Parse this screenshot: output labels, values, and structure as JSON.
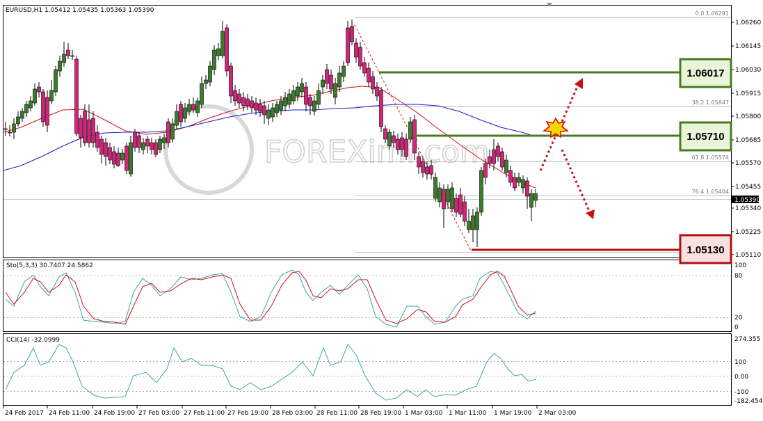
{
  "symbol_header": "EURUSD,H1  1.05412 1.05435 1.05363 1.05390",
  "current_price": "1.05390",
  "watermark": "FOREXimf.com",
  "price_axis": [
    "1.06260",
    "1.06145",
    "1.06030",
    "1.05915",
    "1.05800",
    "1.05685",
    "1.05570",
    "1.05455",
    "1.05340",
    "1.05225",
    "1.05110"
  ],
  "fibo": [
    "0.0  1.06291",
    "38.2  1.05847",
    "61.8  1.05574",
    "76.4  1.05404"
  ],
  "levels": [
    {
      "label": "1.06017",
      "color": "#4a7a20",
      "fill": "#e9f5d8"
    },
    {
      "label": "1.05710",
      "color": "#4a7a20",
      "fill": "#e9f5d8"
    },
    {
      "label": "1.05130",
      "color": "#b01010",
      "fill": "#fbe0e0"
    }
  ],
  "stoch": {
    "title": "Sto(5,3,3) 30.7407 24.5862",
    "axis": [
      "100",
      "80",
      "20",
      "0"
    ]
  },
  "cci": {
    "title": "CCI(14) -32.0999",
    "axis": [
      "274.355",
      "100",
      "0.00",
      "-100",
      "-182.4542"
    ]
  },
  "time_axis": [
    "24 Feb 2017",
    "24 Feb 11:00",
    "24 Feb 19:00",
    "27 Feb 03:00",
    "27 Feb 11:00",
    "27 Feb 19:00",
    "28 Feb 03:00",
    "28 Feb 11:00",
    "28 Feb 19:00",
    "1 Mar 03:00",
    "1 Mar 11:00",
    "1 Mar 19:00",
    "2 Mar 03:00"
  ],
  "colors": {
    "bull": "#3c7a2c",
    "bear": "#d4247a",
    "ma_fast": "#d41010",
    "ma_slow": "#1a1ad4",
    "stoch_main": "#3aa6a6",
    "stoch_signal": "#d41010",
    "cci": "#3aa6a6"
  }
}
